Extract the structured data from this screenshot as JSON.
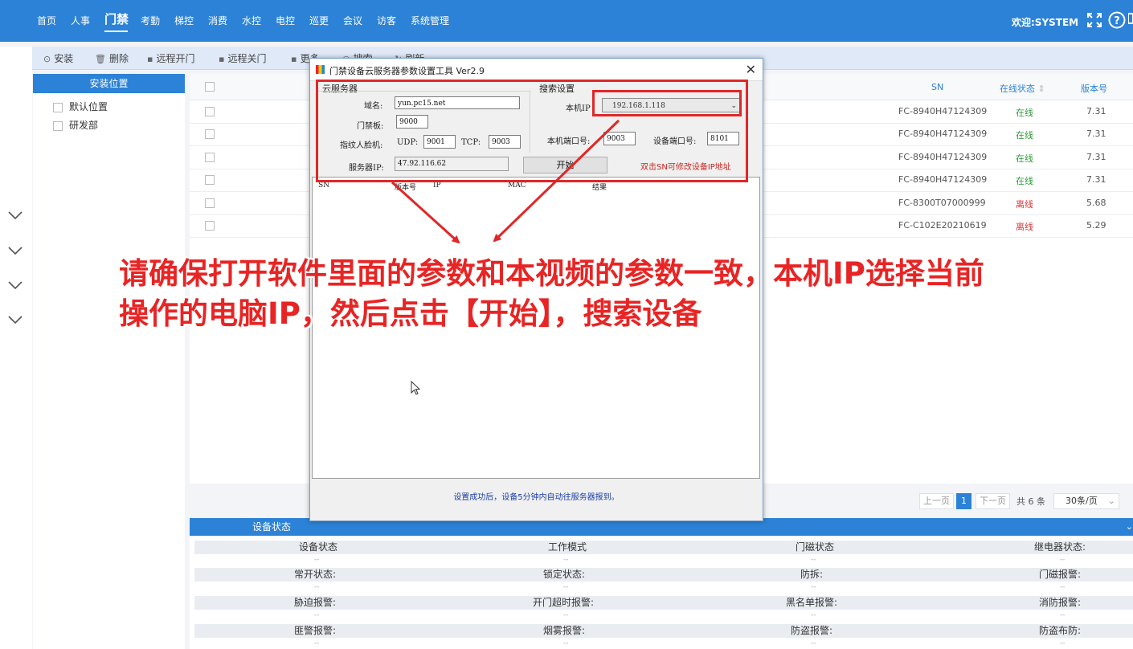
{
  "nav": {
    "items": [
      "首页",
      "人事",
      "门禁",
      "考勤",
      "梯控",
      "消费",
      "水控",
      "电控",
      "巡更",
      "会议",
      "访客",
      "系统管理"
    ],
    "active": "门禁",
    "welcome": "欢迎:SYSTEM"
  },
  "toolbar": {
    "install": "安装",
    "delete": "删除",
    "remote_open": "远程开门",
    "remote_close": "远程关门",
    "more": "更多",
    "search": "搜索",
    "refresh": "刷新"
  },
  "location_panel": {
    "title": "安装位置",
    "items": [
      "默认位置",
      "研发部"
    ]
  },
  "table": {
    "headers": {
      "sn": "SN",
      "status": "在线状态",
      "version": "版本号"
    },
    "rows": [
      {
        "sn": "FC-8940H47124309",
        "status": "在线",
        "version": "7.31"
      },
      {
        "sn": "FC-8940H47124309",
        "status": "在线",
        "version": "7.31"
      },
      {
        "sn": "FC-8940H47124309",
        "status": "在线",
        "version": "7.31"
      },
      {
        "sn": "FC-8940H47124309",
        "status": "在线",
        "version": "7.31"
      },
      {
        "sn": "FC-8300T07000999",
        "status": "离线",
        "version": "5.68"
      },
      {
        "sn": "FC-C102E20210619",
        "status": "离线",
        "version": "5.29"
      }
    ]
  },
  "pager": {
    "prev": "上一页",
    "current": "1",
    "next": "下一页",
    "total": "共 6 条",
    "per_page": "30条/页"
  },
  "device_status": {
    "title": "设备状态",
    "rows": [
      [
        "设备状态",
        "工作模式",
        "门磁状态",
        "继电器状态:"
      ],
      [
        "常开状态:",
        "锁定状态:",
        "防拆:",
        "门磁报警:"
      ],
      [
        "胁迫报警:",
        "开门超时报警:",
        "黑名单报警:",
        "消防报警:"
      ],
      [
        "匪警报警:",
        "烟雾报警:",
        "防盗报警:",
        "防盗布防:"
      ]
    ],
    "empty_value": "--"
  },
  "dialog": {
    "title": "门禁设备云服务器参数设置工具 Ver2.9",
    "cloud_group": "云服务器",
    "search_group": "搜索设置",
    "domain_label": "域名:",
    "domain_value": "yun.pc15.net",
    "door_label": "门禁板:",
    "door_value": "9000",
    "face_label": "指纹人脸机:",
    "udp_label": "UDP:",
    "udp_value": "9001",
    "tcp_label": "TCP:",
    "tcp_value": "9003",
    "local_ip_label": "本机IP",
    "local_ip_value": "192.168.1.118",
    "local_port_label": "本机端口号:",
    "local_port_value": "9003",
    "device_port_label": "设备端口号:",
    "device_port_value": "8101",
    "server_ip_label": "服务器IP:",
    "server_ip_value": "47.92.116.62",
    "start_button": "开始",
    "hint": "双击SN可修改设备IP地址",
    "columns": [
      "SN",
      "版本号",
      "IP",
      "MAC",
      "结果"
    ],
    "footer": "设置成功后，设备5分钟内自动往服务器报到。"
  },
  "overlay": {
    "line1": "请确保打开软件里面的参数和本视频的参数一致，本机IP选择当前",
    "line2": "操作的电脑IP，然后点击【开始】，搜索设备"
  },
  "colors": {
    "brand": "#2c82d6",
    "annotation_red": "#e82424",
    "online": "#2e9b3a",
    "offline": "#e03434"
  }
}
